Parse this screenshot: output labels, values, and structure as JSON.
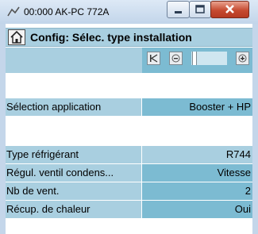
{
  "window": {
    "title": "00:000 AK-PC 772A",
    "icon": "signal-icon"
  },
  "header": {
    "title": "Config: Sélec. type installation",
    "home_icon": "home-icon"
  },
  "nav": {
    "first_icon": "first-page-icon",
    "prev_icon": "prev-page-icon",
    "next_icon": "next-page-icon"
  },
  "rows": [
    {
      "label": "Sélection application",
      "value": "Booster + HP"
    },
    {
      "label": "Type réfrigérant",
      "value": "R744"
    },
    {
      "label": "Régul. ventil condens...",
      "value": "Vitesse"
    },
    {
      "label": "Nb de vent.",
      "value": "2"
    },
    {
      "label": "Récup. de chaleur",
      "value": "Oui"
    }
  ],
  "colors": {
    "label_bg": "#a9cfe0",
    "value_bg": "#7cbbd2",
    "close_button": "#c64b31"
  }
}
